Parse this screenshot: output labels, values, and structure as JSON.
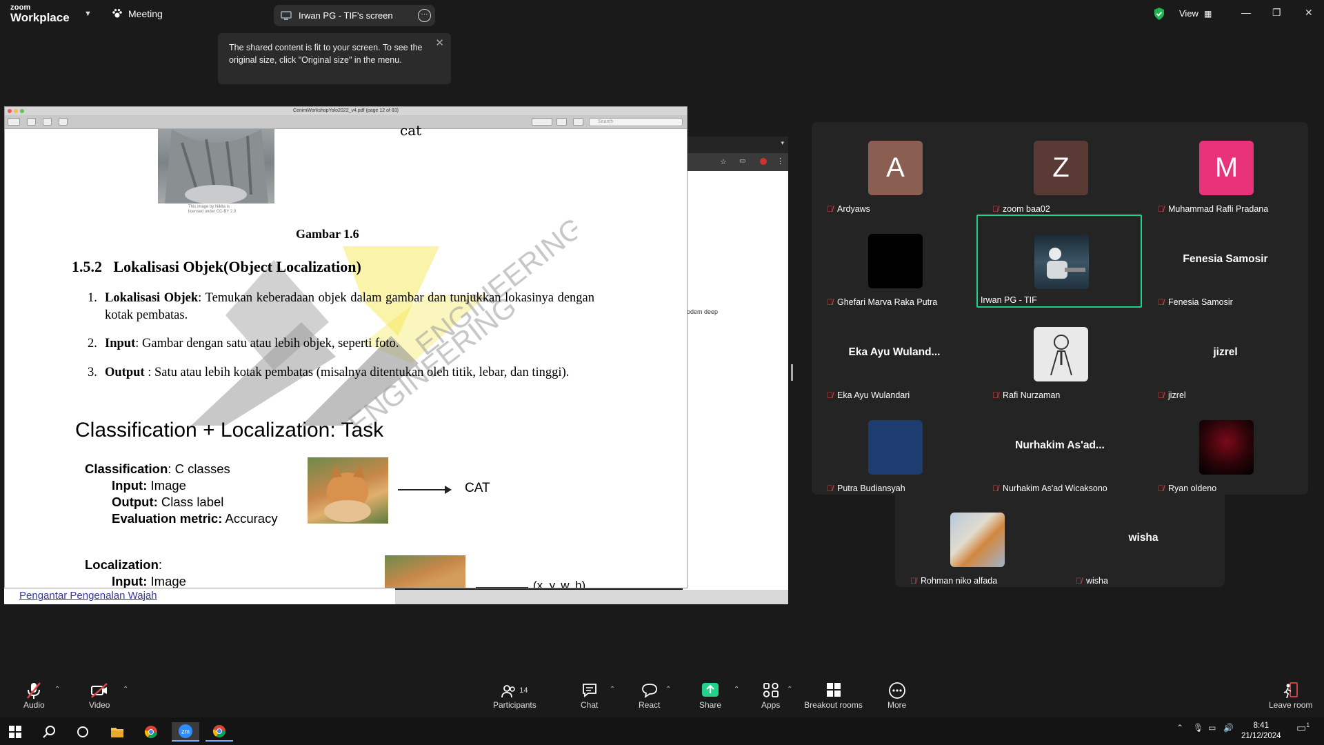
{
  "app": {
    "brand_small": "zoom",
    "brand_big": "Workplace",
    "meeting_label": "Meeting",
    "view_label": "View"
  },
  "share": {
    "label": "Irwan PG - TIF's screen"
  },
  "tooltip": {
    "text": "The shared content is fit to your screen. To see the original size, click \"Original size\" in the menu."
  },
  "pdf": {
    "window_title": "CenimWorkshopYolo2022_v4.pdf (page 12 of 83)",
    "search_placeholder": "Search",
    "cat_heading": "cat",
    "cat_caption_1": "This image by Nikita is",
    "cat_caption_2": "licensed under CC-BY 2.0",
    "figure_caption": "Gambar 1.6",
    "section_number": "1.5.2",
    "section_title": "Lokalisasi Objek(Object Localization)",
    "items": [
      {
        "num": "1.",
        "term": "Lokalisasi Objek",
        "text": ": Temukan keberadaan objek dalam gambar dan tunjukkan lokasinya dengan kotak pembatas."
      },
      {
        "num": "2.",
        "term": "Input",
        "text": ": Gambar dengan satu atau lebih objek, seperti foto."
      },
      {
        "num": "3.",
        "term": "Output",
        "text": " : Satu atau lebih kotak pembatas (misalnya ditentukan oleh titik, lebar, dan tinggi)."
      }
    ],
    "slide_title": "Classification + Localization: Task",
    "classification_label": "Classification",
    "classification_value": ": C classes",
    "input_label": "Input:",
    "input_value": " Image",
    "output_label": "Output:",
    "output_value": " Class label",
    "metric_label": "Evaluation metric:",
    "metric_value": " Accuracy",
    "cat_output": "CAT",
    "localization_label": "Localization",
    "localization_suffix": ":",
    "loc_input_label": "Input:",
    "loc_input_value": " Image",
    "loc_output": "(x, y, w, h)",
    "watermark": "ENGINEERING",
    "watermark_2": "R ENGINEERING"
  },
  "browser": {
    "fragment_text": "odem deep",
    "bottom_link": "Pengantar Pengenalan Wajah"
  },
  "participants": [
    {
      "name": "Ardyaws",
      "avatar_letter": "A",
      "avatar_color": "#8b5e52"
    },
    {
      "name": "zoom baa02",
      "avatar_letter": "Z",
      "avatar_color": "#5a3a34"
    },
    {
      "name": "Muhammad Rafli Pradana",
      "avatar_letter": "M",
      "avatar_color": "#e8337a"
    },
    {
      "name": "Ghefari Marva Raka Putra",
      "avatar_color": "#000000"
    },
    {
      "name": "Irwan PG - TIF",
      "active_speaker": true
    },
    {
      "name": "Fenesia Samosir",
      "display_name": "Fenesia Samosir"
    },
    {
      "name": "Eka Ayu Wulandari",
      "display_name": "Eka Ayu Wuland..."
    },
    {
      "name": "Rafi Nurzaman"
    },
    {
      "name": "jizrel",
      "display_name": "jizrel"
    },
    {
      "name": "Putra Budiansyah",
      "avatar_color": "#1d3c70"
    },
    {
      "name": "Nurhakim As'ad Wicaksono",
      "display_name": "Nurhakim  As'ad..."
    },
    {
      "name": "Ryan oldeno"
    },
    {
      "name": "Rohman niko alfada"
    },
    {
      "name": "wisha",
      "display_name": "wisha"
    }
  ],
  "controls": {
    "audio": "Audio",
    "video": "Video",
    "participants": "Participants",
    "participants_count": "14",
    "chat": "Chat",
    "react": "React",
    "share": "Share",
    "apps": "Apps",
    "breakout": "Breakout rooms",
    "more": "More",
    "leave": "Leave room"
  },
  "taskbar": {
    "time": "8:41",
    "date": "21/12/2024",
    "notification_count": "1"
  },
  "colors": {
    "active_speaker": "#23d18b",
    "share_green": "#23d18b",
    "muted_red": "#e04848",
    "shield_green": "#1fb354"
  }
}
